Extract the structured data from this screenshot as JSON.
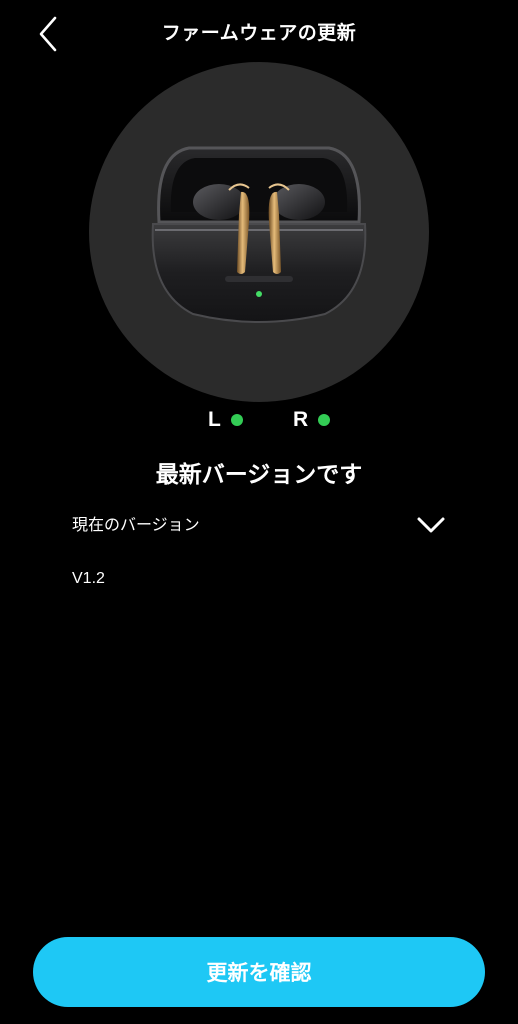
{
  "header": {
    "title": "ファームウェアの更新",
    "back_icon": "chevron-left-icon"
  },
  "device": {
    "image_subject": "earbuds-in-open-charging-case",
    "left_label": "L",
    "right_label": "R",
    "status_color": "#33cc55"
  },
  "status": {
    "message": "最新バージョンです"
  },
  "version": {
    "label": "現在のバージョン",
    "value": "V1.2",
    "toggle_icon": "chevron-down-icon"
  },
  "footer": {
    "confirm_label": "更新を確認",
    "accent_color": "#1ec8f5"
  }
}
